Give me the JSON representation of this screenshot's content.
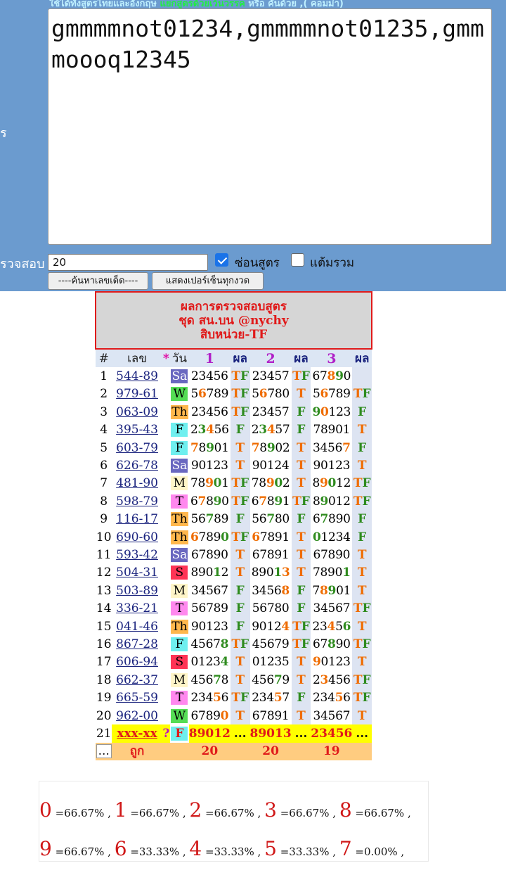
{
  "form": {
    "hint_text": "ใช้ได้ทั้งสูตรไทยและอังกฤษ",
    "hint_highlight": "แยกสูตรด้วยเว้นวรรค",
    "hint_tail": "หรือ คั่นด้วย ,( คอมม่า)",
    "side_label_formula": "ร",
    "side_label_count": "รวจสอบ",
    "formula_value": "gmmmmnot01234,gmmmmnot01235,gmmmoooq12345",
    "count_value": "20",
    "hide_formula_label": "ซ่อนสูตร",
    "hide_formula_checked": true,
    "total_score_label": "แต้มรวม",
    "total_score_checked": false,
    "find_button": "----ค้นหาเลขเด็ด----",
    "percent_button": "แสดงเปอร์เซ็นทุกงวด"
  },
  "results": {
    "title_line1": "ผลการตรวจสอบสูตร",
    "title_line2": "ชุด สน.บน @nychy",
    "title_line3": "สิบหน่วย-TF",
    "headers": {
      "idx": "#",
      "num": "เลข",
      "star": "*",
      "day": "วัน",
      "set1": "1",
      "res1": "ผล",
      "set2": "2",
      "res2": "ผล",
      "set3": "3",
      "res3": "ผล"
    },
    "rows": [
      {
        "no": "1",
        "num": "544-89",
        "day": "Sa",
        "s1": "23456",
        "r1": "TF",
        "s2": "23457",
        "r2": "TF",
        "s3": "67890",
        "r3": ""
      },
      {
        "no": "2",
        "num": "979-61",
        "day": "W",
        "s1": "56789",
        "r1": "TF",
        "s2": "56780",
        "r2": "T",
        "s3": "56789",
        "r3": "TF"
      },
      {
        "no": "3",
        "num": "063-09",
        "day": "Th",
        "s1": "23456",
        "r1": "TF",
        "s2": "23457",
        "r2": "F",
        "s3": "90123",
        "r3": "F"
      },
      {
        "no": "4",
        "num": "395-43",
        "day": "F",
        "s1": "23456",
        "r1": "F",
        "s2": "23457",
        "r2": "F",
        "s3": "78901",
        "r3": "T"
      },
      {
        "no": "5",
        "num": "603-79",
        "day": "F",
        "s1": "78901",
        "r1": "T",
        "s2": "78902",
        "r2": "T",
        "s3": "34567",
        "r3": "F"
      },
      {
        "no": "6",
        "num": "626-78",
        "day": "Sa",
        "s1": "90123",
        "r1": "T",
        "s2": "90124",
        "r2": "T",
        "s3": "90123",
        "r3": "T"
      },
      {
        "no": "7",
        "num": "481-90",
        "day": "M",
        "s1": "78901",
        "r1": "TF",
        "s2": "78902",
        "r2": "T",
        "s3": "89012",
        "r3": "TF"
      },
      {
        "no": "8",
        "num": "598-79",
        "day": "T",
        "s1": "67890",
        "r1": "TF",
        "s2": "67891",
        "r2": "TF",
        "s3": "89012",
        "r3": "TF"
      },
      {
        "no": "9",
        "num": "116-17",
        "day": "Th",
        "s1": "56789",
        "r1": "F",
        "s2": "56780",
        "r2": "F",
        "s3": "67890",
        "r3": "F"
      },
      {
        "no": "10",
        "num": "690-60",
        "day": "Th",
        "s1": "67890",
        "r1": "TF",
        "s2": "67891",
        "r2": "T",
        "s3": "01234",
        "r3": "F"
      },
      {
        "no": "11",
        "num": "593-42",
        "day": "Sa",
        "s1": "67890",
        "r1": "T",
        "s2": "67891",
        "r2": "T",
        "s3": "67890",
        "r3": "T"
      },
      {
        "no": "12",
        "num": "504-31",
        "day": "S",
        "s1": "89012",
        "r1": "T",
        "s2": "89013",
        "r2": "T",
        "s3": "78901",
        "r3": "T"
      },
      {
        "no": "13",
        "num": "503-89",
        "day": "M",
        "s1": "34567",
        "r1": "F",
        "s2": "34568",
        "r2": "F",
        "s3": "78901",
        "r3": "T"
      },
      {
        "no": "14",
        "num": "336-21",
        "day": "T",
        "s1": "56789",
        "r1": "F",
        "s2": "56780",
        "r2": "F",
        "s3": "34567",
        "r3": "TF"
      },
      {
        "no": "15",
        "num": "041-46",
        "day": "Th",
        "s1": "90123",
        "r1": "F",
        "s2": "90124",
        "r2": "TF",
        "s3": "23456",
        "r3": "T"
      },
      {
        "no": "16",
        "num": "867-28",
        "day": "F",
        "s1": "45678",
        "r1": "TF",
        "s2": "45679",
        "r2": "TF",
        "s3": "67890",
        "r3": "TF"
      },
      {
        "no": "17",
        "num": "606-94",
        "day": "S",
        "s1": "01234",
        "r1": "T",
        "s2": "01235",
        "r2": "T",
        "s3": "90123",
        "r3": "T"
      },
      {
        "no": "18",
        "num": "662-37",
        "day": "M",
        "s1": "45678",
        "r1": "T",
        "s2": "45679",
        "r2": "T",
        "s3": "23456",
        "r3": "TF"
      },
      {
        "no": "19",
        "num": "665-59",
        "day": "T",
        "s1": "23456",
        "r1": "TF",
        "s2": "23457",
        "r2": "F",
        "s3": "23456",
        "r3": "TF"
      },
      {
        "no": "20",
        "num": "962-00",
        "day": "W",
        "s1": "67890",
        "r1": "T",
        "s2": "67891",
        "r2": "T",
        "s3": "34567",
        "r3": "T"
      }
    ],
    "next_row": {
      "no": "21",
      "num": "xxx-xx",
      "q": "?",
      "day": "F",
      "s1": "89012",
      "r1": "...",
      "s2": "89013",
      "r2": "...",
      "s3": "23456",
      "r3": "..."
    },
    "summary": {
      "dots": "...",
      "label": "ถูก",
      "t1": "20",
      "t2": "20",
      "t3": "19"
    }
  },
  "percentages": {
    "line1": [
      {
        "digit": "0",
        "value": "=66.67% ,"
      },
      {
        "digit": "1",
        "value": "=66.67% ,"
      },
      {
        "digit": "2",
        "value": "=66.67% ,"
      },
      {
        "digit": "3",
        "value": "=66.67% ,"
      },
      {
        "digit": "8",
        "value": "=66.67% ,"
      }
    ],
    "line2": [
      {
        "digit": "9",
        "value": "=66.67% ,"
      },
      {
        "digit": "6",
        "value": "=33.33% ,"
      },
      {
        "digit": "4",
        "value": "=33.33% ,"
      },
      {
        "digit": "5",
        "value": "=33.33% ,"
      },
      {
        "digit": "7",
        "value": "=0.00% ,"
      }
    ]
  }
}
